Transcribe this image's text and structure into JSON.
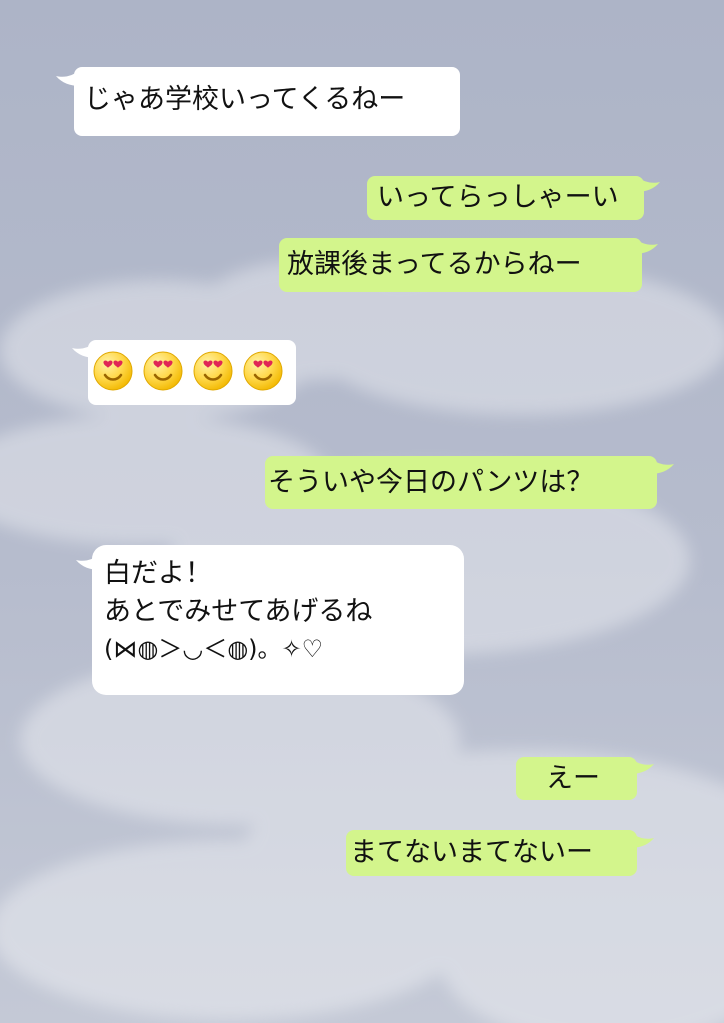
{
  "chat": {
    "background_color": "#aeb5c8",
    "messages": [
      {
        "side": "left",
        "type": "text",
        "text": "じゃあ学校いってくるねー"
      },
      {
        "side": "right",
        "type": "text",
        "text": "いってらっしゃーい"
      },
      {
        "side": "right",
        "type": "text",
        "text": "放課後まってるからねー"
      },
      {
        "side": "left",
        "type": "emoji",
        "emoji_icons": [
          "heart-eyes-emoji",
          "heart-eyes-emoji",
          "heart-eyes-emoji",
          "heart-eyes-emoji"
        ]
      },
      {
        "side": "right",
        "type": "text",
        "text": "そういや今日のパンツは？"
      },
      {
        "side": "left",
        "type": "multiline",
        "lines": [
          "白だよ！",
          "あとでみせてあげるね",
          "(⋈◍＞◡＜◍)。✧♡"
        ]
      },
      {
        "side": "right",
        "type": "text",
        "text": "えー"
      },
      {
        "side": "right",
        "type": "text",
        "text": "まてないまてないー"
      }
    ]
  },
  "colors": {
    "left_bubble": "#ffffff",
    "right_bubble": "#d3f58c",
    "text": "#111111"
  }
}
